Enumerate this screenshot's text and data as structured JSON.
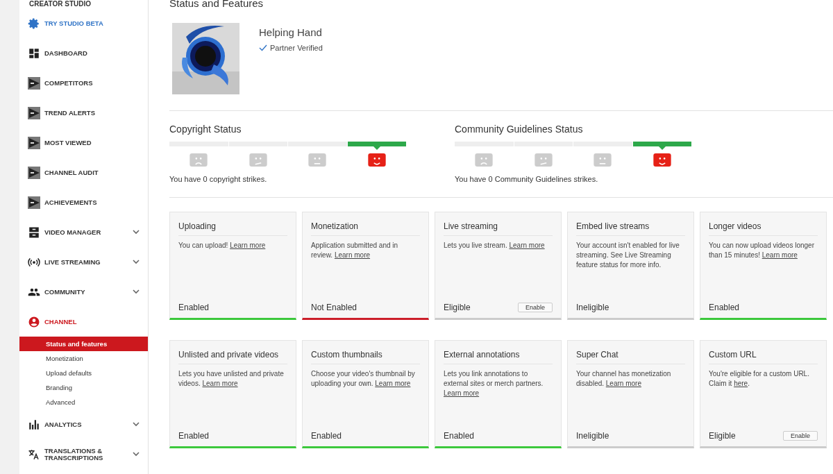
{
  "sidebar": {
    "header": "CREATOR STUDIO",
    "items": [
      {
        "kind": "promo",
        "label": "TRY STUDIO BETA",
        "expandable": false,
        "selected": false
      },
      {
        "kind": "dashboard",
        "label": "DASHBOARD",
        "expandable": false,
        "selected": false
      },
      {
        "kind": "plugin",
        "label": "COMPETITORS",
        "expandable": false,
        "selected": false
      },
      {
        "kind": "plugin",
        "label": "TREND ALERTS",
        "expandable": false,
        "selected": false
      },
      {
        "kind": "plugin",
        "label": "MOST VIEWED",
        "expandable": false,
        "selected": false
      },
      {
        "kind": "plugin",
        "label": "CHANNEL AUDIT",
        "expandable": false,
        "selected": false
      },
      {
        "kind": "plugin",
        "label": "ACHIEVEMENTS",
        "expandable": false,
        "selected": false
      },
      {
        "kind": "videos",
        "label": "VIDEO MANAGER",
        "expandable": true,
        "selected": false
      },
      {
        "kind": "live",
        "label": "LIVE STREAMING",
        "expandable": true,
        "selected": false
      },
      {
        "kind": "people",
        "label": "COMMUNITY",
        "expandable": true,
        "selected": false
      },
      {
        "kind": "channel",
        "label": "CHANNEL",
        "expandable": false,
        "selected": true,
        "children": [
          {
            "label": "Status and features",
            "selected": true
          },
          {
            "label": "Monetization",
            "selected": false
          },
          {
            "label": "Upload defaults",
            "selected": false
          },
          {
            "label": "Branding",
            "selected": false
          },
          {
            "label": "Advanced",
            "selected": false
          }
        ]
      },
      {
        "kind": "analytics",
        "label": "ANALYTICS",
        "expandable": true,
        "selected": false
      },
      {
        "kind": "translate",
        "label": "TRANSLATIONS & TRANSCRIPTIONS",
        "expandable": true,
        "selected": false
      }
    ]
  },
  "page": {
    "title": "Status and Features",
    "channel": {
      "name": "Helping Hand",
      "badge": "Partner Verified"
    }
  },
  "statuses": [
    {
      "title": "Copyright Status",
      "faces": [
        {
          "kind": "sad",
          "selected": false
        },
        {
          "kind": "unsure",
          "selected": false
        },
        {
          "kind": "neutral",
          "selected": false
        },
        {
          "kind": "happy",
          "selected": true
        }
      ],
      "note": "You have 0 copyright strikes."
    },
    {
      "title": "Community Guidelines Status",
      "faces": [
        {
          "kind": "sad",
          "selected": false
        },
        {
          "kind": "unsure",
          "selected": false
        },
        {
          "kind": "neutral",
          "selected": false
        },
        {
          "kind": "happy",
          "selected": true
        }
      ],
      "note": "You have 0 Community Guidelines strikes."
    }
  ],
  "features": [
    {
      "title": "Uploading",
      "description": [
        {
          "kind": "text",
          "text": "You can upload! "
        },
        {
          "kind": "link",
          "text": "Learn more"
        }
      ],
      "status": "Enabled",
      "color": "#3cc83c"
    },
    {
      "title": "Monetization",
      "description": [
        {
          "kind": "text",
          "text": "Application submitted and in review. "
        },
        {
          "kind": "link",
          "text": "Learn more"
        }
      ],
      "status": "Not Enabled",
      "color": "#cc1f2a"
    },
    {
      "title": "Live streaming",
      "description": [
        {
          "kind": "text",
          "text": "Lets you live stream. "
        },
        {
          "kind": "link",
          "text": "Learn more"
        }
      ],
      "status": "Eligible",
      "color": "#cccccc",
      "button": "Enable"
    },
    {
      "title": "Embed live streams",
      "description": [
        {
          "kind": "text",
          "text": "Your account isn't enabled for live streaming. See Live Streaming feature status for more info."
        }
      ],
      "status": "Ineligible",
      "color": "#cccccc"
    },
    {
      "title": "Longer videos",
      "description": [
        {
          "kind": "text",
          "text": "You can now upload videos longer than 15 minutes! "
        },
        {
          "kind": "link",
          "text": "Learn more"
        }
      ],
      "status": "Enabled",
      "color": "#3cc83c"
    },
    {
      "title": "Unlisted and private videos",
      "description": [
        {
          "kind": "text",
          "text": "Lets you have unlisted and private videos. "
        },
        {
          "kind": "link",
          "text": "Learn more"
        }
      ],
      "status": "Enabled",
      "color": "#3cc83c"
    },
    {
      "title": "Custom thumbnails",
      "description": [
        {
          "kind": "text",
          "text": "Choose your video's thumbnail by uploading your own. "
        },
        {
          "kind": "link",
          "text": "Learn more"
        }
      ],
      "status": "Enabled",
      "color": "#3cc83c"
    },
    {
      "title": "External annotations",
      "description": [
        {
          "kind": "text",
          "text": "Lets you link annotations to external sites or merch partners. "
        },
        {
          "kind": "link",
          "text": "Learn more"
        }
      ],
      "status": "Enabled",
      "color": "#3cc83c"
    },
    {
      "title": "Super Chat",
      "description": [
        {
          "kind": "text",
          "text": "Your channel has monetization disabled. "
        },
        {
          "kind": "link",
          "text": "Learn more"
        }
      ],
      "status": "Ineligible",
      "color": "#cccccc"
    },
    {
      "title": "Custom URL",
      "description": [
        {
          "kind": "text",
          "text": "You're eligible for a custom URL. Claim it "
        },
        {
          "kind": "link",
          "text": "here"
        },
        {
          "kind": "text",
          "text": "."
        }
      ],
      "status": "Eligible",
      "color": "#cccccc",
      "button": "Enable"
    }
  ]
}
